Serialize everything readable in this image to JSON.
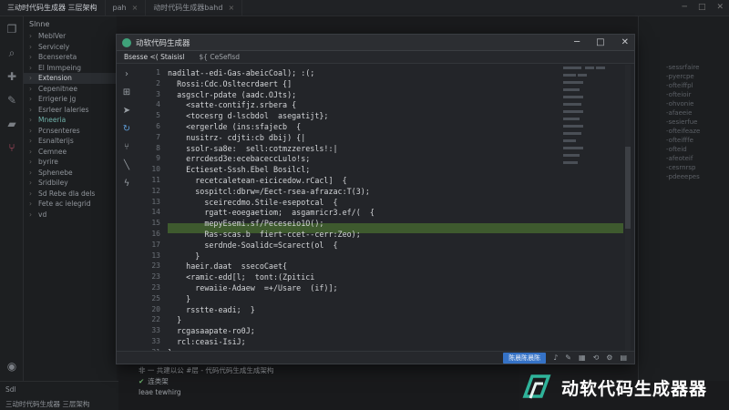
{
  "bg_tabs": [
    {
      "label": "三动时代码生成器 三层架构"
    },
    {
      "label": "pah"
    },
    {
      "label": "动时代码生成器bahd"
    }
  ],
  "explorer": {
    "header": "Slnne",
    "items": [
      {
        "label": "MeblVer"
      },
      {
        "label": "Servicely"
      },
      {
        "label": "Bcensereta"
      },
      {
        "label": "El Immpeing"
      },
      {
        "label": "Extension"
      },
      {
        "label": "Cepenitnee"
      },
      {
        "label": "Errigerie jg"
      },
      {
        "label": "Esrleer laleries"
      },
      {
        "label": "Mneeria"
      },
      {
        "label": "Pcnsenteres"
      },
      {
        "label": "Esnalterijs"
      },
      {
        "label": "Cemnee"
      },
      {
        "label": "byrire"
      },
      {
        "label": "Sphenebe"
      },
      {
        "label": "Sridbiley"
      },
      {
        "label": "Sd Rebe dla dels"
      },
      {
        "label": "Fete ac ielegrid"
      },
      {
        "label": "vd"
      }
    ]
  },
  "bg_status": {
    "line1": "Sdl",
    "line2": "三动时代码生成器 三层架构"
  },
  "terminal": {
    "line1": "非 一 共建以公 #层 - 代码代码生成生成架构",
    "line2": "连类架",
    "line3": "Ieae tewhirg"
  },
  "window": {
    "title": "动软代码生成器",
    "tabs": [
      {
        "label": "Bsesse <( Staisisl"
      },
      {
        "label": "${ CeSefisd"
      }
    ],
    "status_button": "陈晨陈晨陈",
    "line_numbers": [
      "1",
      "2",
      "3",
      "4",
      "5",
      "6",
      "7",
      "8",
      "9",
      "10",
      "11",
      "12",
      "13",
      "14",
      "15",
      "16",
      "17",
      "13",
      "23",
      "23",
      "23",
      "25",
      "20",
      "22",
      "33",
      "33",
      "31",
      "33",
      "33",
      "31"
    ],
    "code_lines": [
      "nadilat--edi-Gas-abeicCoal); :(;",
      "  Rossi:Cdc.Osltecrdaert {]",
      "  asgsclr-pdate (aadc.OJts);",
      "    <satte-contifjz.srbera {",
      "    <tocesrg d-lscbdol  asegatijt};",
      "    <ergerlde (ins:sfajecb  {",
      "    nusitrz- cdjti:cb dbij) {|",
      "    ssolr-sa8e:  sell:cotmzzeresls!:|",
      "    errcdesd3e:ecebaceccLulo!s;",
      "    Ectieset-Sssh.Ebel Bosilcl;",
      "      recetcaletean-eicicedow.rCacl]  {",
      "      sospitcl:dbrw=/Eect-rsea-afrazac:T(3);",
      "        sceirecdmo.Stile-esepotcal  {",
      "        rgatt-eoegaetiom;  asgamricr3.ef/(  {",
      "        mepyEsemi.sf/Peceseio1O();",
      "        Ras-scas.b  fiert-ccet--cerr:Zeo);",
      "        serdnde-Soalidc=Scarect(ol  {",
      "      }",
      "    haeir.daat  ssecoCaet{",
      "    <ramic-edd[l;  tont:(Zpitici",
      "      rewaiie-Adaew  =+/Usare  (if)];",
      "    }",
      "    rsstte-eadi;  }",
      "  }",
      "  rcgasaapate-ro0J;",
      "  rcl:ceasi-IsiJ;",
      "}"
    ]
  },
  "right_panel": {
    "lines": [
      "-sessrfaire",
      "-pyercpe",
      "-ofteiffpl",
      "-ofteioir",
      "-ohvonie",
      "-afaeeie",
      "-sesierfue",
      "-ofteifeaze",
      "-ofteifffe",
      "-ofteid",
      "-afeoteif",
      "-cesrnrsp",
      "-pdeeepes"
    ]
  },
  "brand": {
    "name": "动软代码生成器器",
    "accent": "#2fb39a"
  }
}
